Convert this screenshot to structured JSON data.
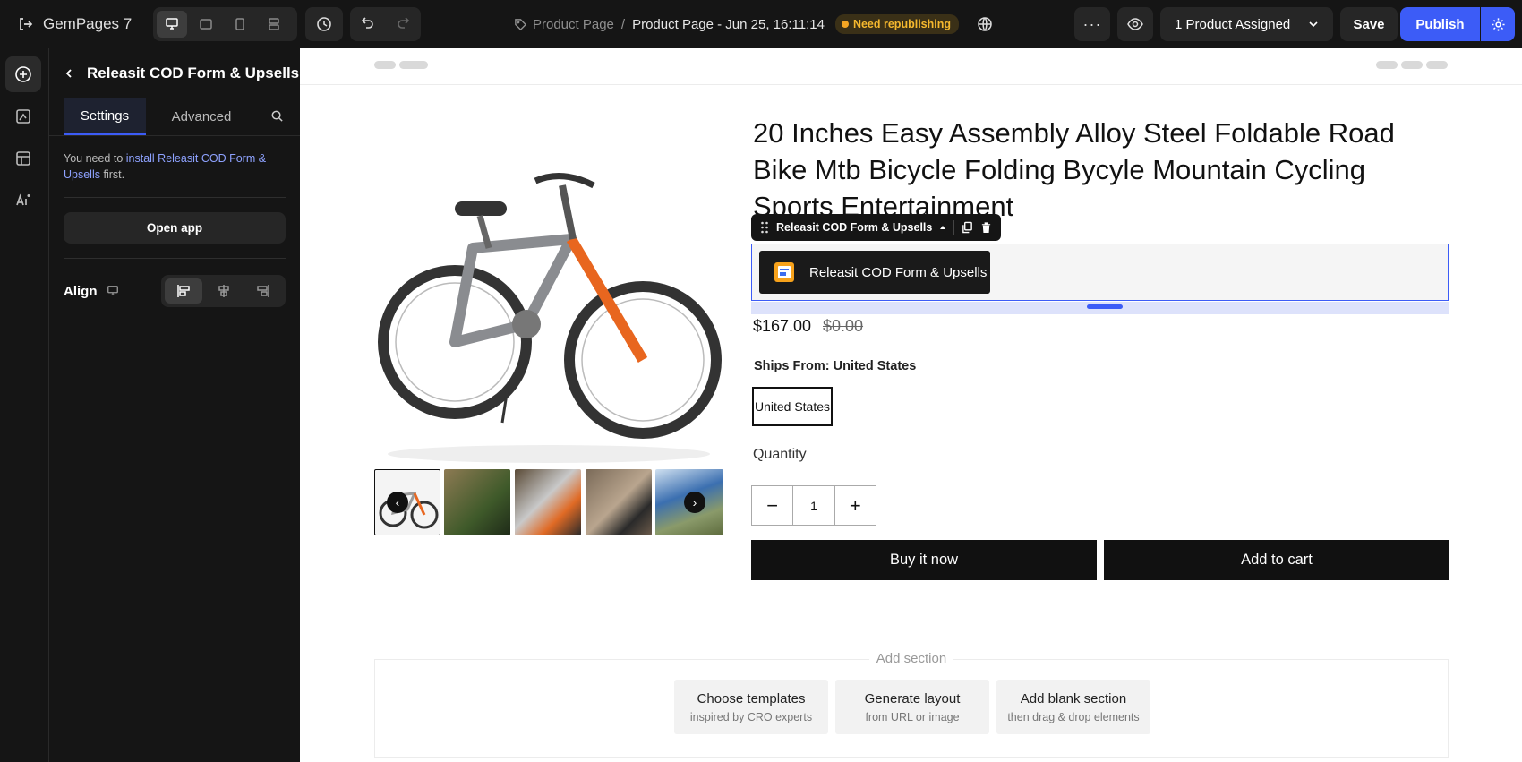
{
  "app": {
    "name": "GemPages 7"
  },
  "topbar": {
    "breadcrumb_page": "Product Page",
    "breadcrumb_sep": "/",
    "breadcrumb_current": "Product Page - Jun 25, 16:11:14",
    "status_badge": "Need republishing",
    "assigned": "1 Product Assigned",
    "save": "Save",
    "publish": "Publish",
    "more": "···"
  },
  "panel": {
    "title": "Releasit COD Form & Upsells",
    "tabs": [
      "Settings",
      "Advanced"
    ],
    "note_prefix": "You need to ",
    "note_link": "install Releasit COD Form & Upsells",
    "note_suffix": " first.",
    "open_app": "Open app",
    "align_label": "Align"
  },
  "product": {
    "title": "20 Inches Easy Assembly Alloy Steel Foldable Road Bike Mtb Bicycle Folding Bycyle Mountain Cycling Sports Entertainment",
    "price": "$167.00",
    "compare_price": "$0.00",
    "ships_from_label": "Ships From: United States",
    "ships_option": "United States",
    "quantity_label": "Quantity",
    "quantity": "1",
    "minus": "−",
    "plus": "+",
    "buy_now": "Buy it now",
    "add_to_cart": "Add to cart",
    "thumb_prev": "‹",
    "thumb_next": "›"
  },
  "selection": {
    "toolbar_label": "Releasit COD Form & Upsells",
    "element_label": "Releasit COD Form & Upsells"
  },
  "add_section": {
    "label": "Add section",
    "options": [
      {
        "title": "Choose templates",
        "sub": "inspired by CRO experts"
      },
      {
        "title": "Generate layout",
        "sub": "from URL or image"
      },
      {
        "title": "Add blank section",
        "sub": "then drag & drop elements"
      }
    ]
  },
  "colors": {
    "accent": "#3c5cf7",
    "badge": "#f5a623",
    "dark": "#151515"
  }
}
